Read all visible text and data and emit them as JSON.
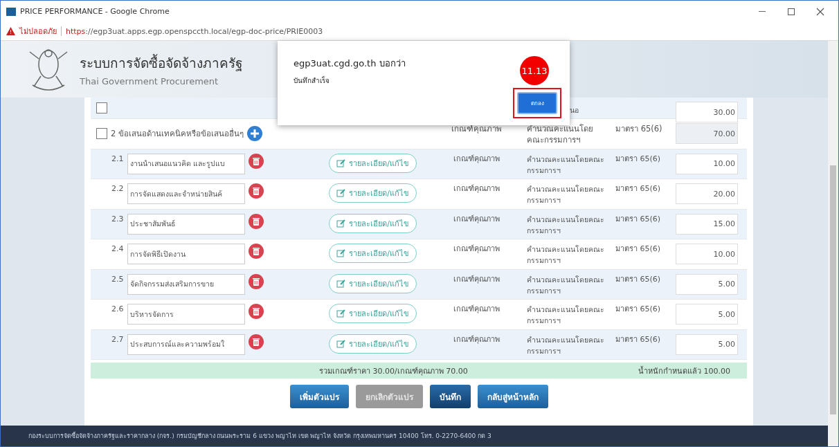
{
  "browser": {
    "title": "PRICE PERFORMANCE - Google Chrome",
    "security_label": "ไม่ปลอดภัย",
    "url_scheme": "https",
    "url_rest": "://egp3uat.apps.egp.openspccth.local/egp-doc-price/PRIE0003"
  },
  "header": {
    "title": "ระบบการจัดซื้อจัดจ้างภาครัฐ",
    "subtitle": "Thai Government Procurement"
  },
  "dialog": {
    "origin": "egp3uat.cgd.go.th บอกว่า",
    "message": "บันทึกสำเร็จ",
    "button": "ตกลง",
    "annotation": "11.13"
  },
  "partial_row": {
    "checked": false,
    "method": "นอ",
    "weight": "30.00"
  },
  "group": {
    "label": "2 ข้อเสนอด้านเทคนิคหรือข้อเสนออื่นๆ",
    "checked": false,
    "criterion": "เกณฑ์คุณภาพ",
    "method": "คำนวณคะแนนโดยคณะกรรมการฯ",
    "law": "มาตรา 65(6)",
    "weight": "70.00"
  },
  "items": [
    {
      "number": "2.1",
      "name": "งานนำเสนอแนวคิด และรูปแบ",
      "detail_button": "รายละเอียด/แก้ไข",
      "criterion": "เกณฑ์คุณภาพ",
      "method": "คำนวณคะแนนโดยคณะกรรมการฯ",
      "law": "มาตรา 65(6)",
      "weight": "10.00"
    },
    {
      "number": "2.2",
      "name": "การจัดแสดงและจำหน่ายสินค้",
      "detail_button": "รายละเอียด/แก้ไข",
      "criterion": "เกณฑ์คุณภาพ",
      "method": "คำนวณคะแนนโดยคณะกรรมการฯ",
      "law": "มาตรา 65(6)",
      "weight": "20.00"
    },
    {
      "number": "2.3",
      "name": "ประชาสัมพันธ์",
      "detail_button": "รายละเอียด/แก้ไข",
      "criterion": "เกณฑ์คุณภาพ",
      "method": "คำนวณคะแนนโดยคณะกรรมการฯ",
      "law": "มาตรา 65(6)",
      "weight": "15.00"
    },
    {
      "number": "2.4",
      "name": "การจัดพิธีเปิดงาน",
      "detail_button": "รายละเอียด/แก้ไข",
      "criterion": "เกณฑ์คุณภาพ",
      "method": "คำนวณคะแนนโดยคณะกรรมการฯ",
      "law": "มาตรา 65(6)",
      "weight": "10.00"
    },
    {
      "number": "2.5",
      "name": "จัดกิจกรรมส่งเสริมการขาย",
      "detail_button": "รายละเอียด/แก้ไข",
      "criterion": "เกณฑ์คุณภาพ",
      "method": "คำนวณคะแนนโดยคณะกรรมการฯ",
      "law": "มาตรา 65(6)",
      "weight": "5.00"
    },
    {
      "number": "2.6",
      "name": "บริหารจัดการ",
      "detail_button": "รายละเอียด/แก้ไข",
      "criterion": "เกณฑ์คุณภาพ",
      "method": "คำนวณคะแนนโดยคณะกรรมการฯ",
      "law": "มาตรา 65(6)",
      "weight": "5.00"
    },
    {
      "number": "2.7",
      "name": "ประสบการณ์และความพร้อมใ",
      "detail_button": "รายละเอียด/แก้ไข",
      "criterion": "เกณฑ์คุณภาพ",
      "method": "คำนวณคะแนนโดยคณะกรรมการฯ",
      "law": "มาตรา 65(6)",
      "weight": "5.00"
    }
  ],
  "summary": {
    "totals": "รวมเกณฑ์ราคา 30.00/เกณฑ์คุณภาพ 70.00",
    "weight_total": "น้ำหนักกำหนดแล้ว 100.00"
  },
  "buttons": [
    {
      "label": "เพิ่มตัวแปร",
      "kind": "primary"
    },
    {
      "label": "ยกเลิกตัวแปร",
      "kind": "disabled"
    },
    {
      "label": "บันทึก",
      "kind": "dark"
    },
    {
      "label": "กลับสู่หน้าหลัก",
      "kind": "primary"
    }
  ],
  "footer": "กองระบบการจัดซื้อจัดจ้างภาครัฐและราคากลาง (กจร.) กรมบัญชีกลาง ถนนพระราม 6 แขวง พญาไท เขต พญาไท จังหวัด กรุงเทพมหานคร 10400 โทร. 0-2270-6400 กด 3"
}
